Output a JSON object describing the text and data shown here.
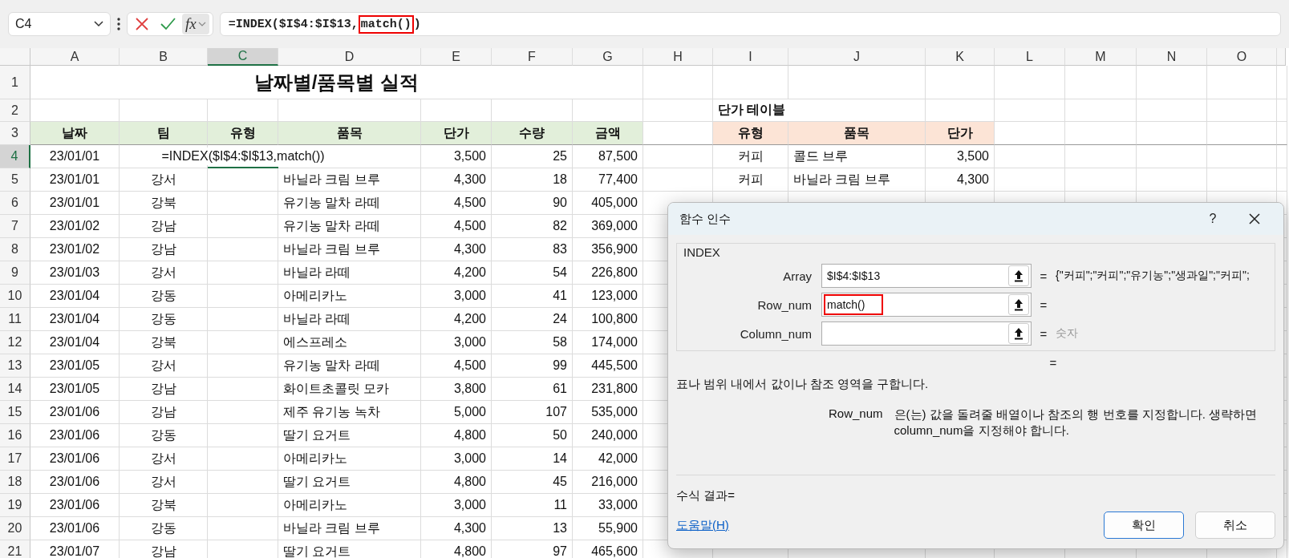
{
  "formula_bar": {
    "name_box": "C4",
    "fx_label": "fx",
    "formula_before": "=INDEX($I$4:$I$13,",
    "formula_highlight": "match()",
    "formula_after": ")"
  },
  "columns": [
    {
      "label": "A",
      "selected": false
    },
    {
      "label": "B",
      "selected": false
    },
    {
      "label": "C",
      "selected": true
    },
    {
      "label": "D",
      "selected": false
    },
    {
      "label": "E",
      "selected": false
    },
    {
      "label": "F",
      "selected": false
    },
    {
      "label": "G",
      "selected": false
    },
    {
      "label": "H",
      "selected": false
    },
    {
      "label": "I",
      "selected": false
    },
    {
      "label": "J",
      "selected": false
    },
    {
      "label": "K",
      "selected": false
    },
    {
      "label": "L",
      "selected": false
    },
    {
      "label": "M",
      "selected": false
    },
    {
      "label": "N",
      "selected": false
    },
    {
      "label": "O",
      "selected": false
    }
  ],
  "row_numbers": [
    {
      "label": "1",
      "selected": false
    },
    {
      "label": "2",
      "selected": false
    },
    {
      "label": "3",
      "selected": false
    },
    {
      "label": "4",
      "selected": true
    },
    {
      "label": "5",
      "selected": false
    },
    {
      "label": "6",
      "selected": false
    },
    {
      "label": "7",
      "selected": false
    },
    {
      "label": "8",
      "selected": false
    },
    {
      "label": "9",
      "selected": false
    },
    {
      "label": "10",
      "selected": false
    },
    {
      "label": "11",
      "selected": false
    },
    {
      "label": "12",
      "selected": false
    },
    {
      "label": "13",
      "selected": false
    },
    {
      "label": "14",
      "selected": false
    },
    {
      "label": "15",
      "selected": false
    },
    {
      "label": "16",
      "selected": false
    },
    {
      "label": "17",
      "selected": false
    },
    {
      "label": "18",
      "selected": false
    },
    {
      "label": "19",
      "selected": false
    },
    {
      "label": "20",
      "selected": false
    },
    {
      "label": "21",
      "selected": false
    }
  ],
  "sheet_title": "날짜별/품목별 실적",
  "headers": [
    "날짜",
    "팀",
    "유형",
    "품목",
    "단가",
    "수량",
    "금액"
  ],
  "rows": [
    {
      "date": "23/01/01",
      "editor": "=INDEX($I$4:$I$13,match())",
      "price": "3,500",
      "qty": "25",
      "amount": "87,500"
    },
    {
      "date": "23/01/01",
      "team": "강서",
      "item": "바닐라 크림 브루",
      "price": "4,300",
      "qty": "18",
      "amount": "77,400"
    },
    {
      "date": "23/01/01",
      "team": "강북",
      "item": "유기농 말차 라떼",
      "price": "4,500",
      "qty": "90",
      "amount": "405,000"
    },
    {
      "date": "23/01/02",
      "team": "강남",
      "item": "유기농 말차 라떼",
      "price": "4,500",
      "qty": "82",
      "amount": "369,000"
    },
    {
      "date": "23/01/02",
      "team": "강남",
      "item": "바닐라 크림 브루",
      "price": "4,300",
      "qty": "83",
      "amount": "356,900"
    },
    {
      "date": "23/01/03",
      "team": "강서",
      "item": "바닐라 라떼",
      "price": "4,200",
      "qty": "54",
      "amount": "226,800"
    },
    {
      "date": "23/01/04",
      "team": "강동",
      "item": "아메리카노",
      "price": "3,000",
      "qty": "41",
      "amount": "123,000"
    },
    {
      "date": "23/01/04",
      "team": "강동",
      "item": "바닐라 라떼",
      "price": "4,200",
      "qty": "24",
      "amount": "100,800"
    },
    {
      "date": "23/01/04",
      "team": "강북",
      "item": "에스프레소",
      "price": "3,000",
      "qty": "58",
      "amount": "174,000"
    },
    {
      "date": "23/01/05",
      "team": "강서",
      "item": "유기농 말차 라떼",
      "price": "4,500",
      "qty": "99",
      "amount": "445,500"
    },
    {
      "date": "23/01/05",
      "team": "강남",
      "item": "화이트초콜릿 모카",
      "price": "3,800",
      "qty": "61",
      "amount": "231,800"
    },
    {
      "date": "23/01/06",
      "team": "강남",
      "item": "제주 유기농 녹차",
      "price": "5,000",
      "qty": "107",
      "amount": "535,000"
    },
    {
      "date": "23/01/06",
      "team": "강동",
      "item": "딸기 요거트",
      "price": "4,800",
      "qty": "50",
      "amount": "240,000"
    },
    {
      "date": "23/01/06",
      "team": "강서",
      "item": "아메리카노",
      "price": "3,000",
      "qty": "14",
      "amount": "42,000"
    },
    {
      "date": "23/01/06",
      "team": "강서",
      "item": "딸기 요거트",
      "price": "4,800",
      "qty": "45",
      "amount": "216,000"
    },
    {
      "date": "23/01/06",
      "team": "강북",
      "item": "아메리카노",
      "price": "3,000",
      "qty": "11",
      "amount": "33,000"
    },
    {
      "date": "23/01/06",
      "team": "강동",
      "item": "바닐라 크림 브루",
      "price": "4,300",
      "qty": "13",
      "amount": "55,900"
    },
    {
      "date": "23/01/07",
      "team": "강남",
      "item": "딸기 요거트",
      "price": "4,800",
      "qty": "97",
      "amount": "465,600"
    }
  ],
  "price_table": {
    "title": "단가 테이블",
    "headers": [
      "유형",
      "품목",
      "단가"
    ],
    "rows": [
      {
        "type": "커피",
        "item": "콜드 브루",
        "price": "3,500"
      },
      {
        "type": "커피",
        "item": "바닐라 크림 브루",
        "price": "4,300"
      }
    ]
  },
  "dialog": {
    "title": "함수 인수",
    "help": "?",
    "function_name": "INDEX",
    "args": [
      {
        "name": "Array",
        "value": "$I$4:$I$13",
        "highlighted": false,
        "equals": "=",
        "result": "{\"커피\";\"커피\";\"유기농\";\"생과일\";\"커피\";",
        "result_greyed": false
      },
      {
        "name": "Row_num",
        "value": "match()",
        "highlighted": true,
        "equals": "="
      },
      {
        "name": "Column_num",
        "highlighted": false,
        "equals": "=",
        "result": "숫자",
        "result_greyed": true
      }
    ],
    "function_equals": "=",
    "description": "표나 범위 내에서 값이나 참조 영역을 구합니다.",
    "arg_help_name": "Row_num",
    "arg_help_text": "은(는) 값을 돌려줄 배열이나 참조의 행 번호를 지정합니다. 생략하면 column_num을 지정해야 합니다.",
    "formula_result": "수식 결과=",
    "help_link": "도움말(H)",
    "buttons": [
      {
        "label": "확인",
        "default": true
      },
      {
        "label": "취소",
        "default": false
      }
    ]
  }
}
